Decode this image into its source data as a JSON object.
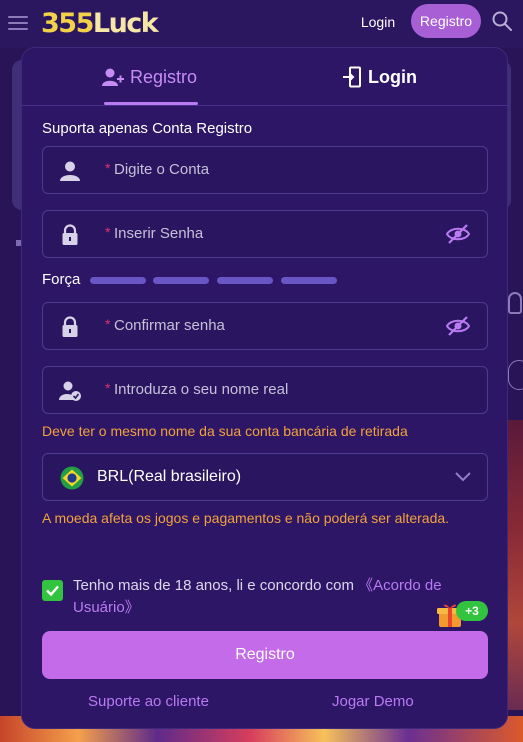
{
  "header": {
    "logo_num": "355",
    "logo_text": "Luck",
    "login_label": "Login",
    "register_label": "Registro"
  },
  "tabs": {
    "register_label": "Registro",
    "login_label": "Login"
  },
  "form": {
    "support_label": "Suporta apenas Conta Registro",
    "required_mark": "*",
    "account_placeholder": "Digite o Conta",
    "password_placeholder": "Inserir Senha",
    "strength_label": "Força",
    "strength_bars": 4,
    "confirm_placeholder": "Confirmar senha",
    "realname_placeholder": "Introduza o seu nome real",
    "realname_warning": "Deve ter o mesmo nome da sua conta bancária de retirada",
    "currency_value": "BRL(Real brasileiro)",
    "currency_warning": "A moeda afeta os jogos e pagamentos e não poderá ser alterada.",
    "agree_text": "Tenho mais de 18 anos, li e concordo com ",
    "agree_link": "《Acordo de Usuário》",
    "agree_checked": true,
    "gift_badge": "+3",
    "submit_label": "Registro",
    "support_link": "Suporte ao cliente",
    "demo_link": "Jogar Demo"
  },
  "colors": {
    "accent": "#c46be9",
    "tab_active": "#b97af2",
    "warning": "#f2a23d",
    "check": "#33c43f",
    "background": "#2a1458"
  },
  "icons": {
    "menu": "hamburger-menu-icon",
    "search": "search-icon",
    "register_tab": "user-plus-icon",
    "login_tab": "login-door-icon",
    "account": "user-icon",
    "password": "lock-icon",
    "eye": "eye-off-icon",
    "realname": "user-check-icon",
    "flag": "brazil-flag-icon",
    "dropdown": "chevron-down-icon",
    "gift": "gift-icon"
  }
}
